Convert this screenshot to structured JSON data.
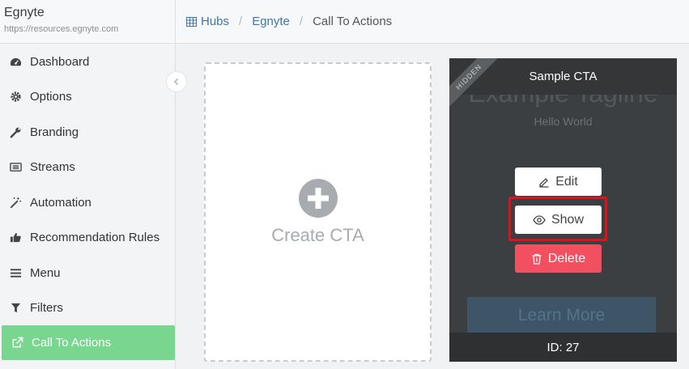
{
  "brand": {
    "title": "Egnyte",
    "url": "https://resources.egnyte.com"
  },
  "sidebar": {
    "items": [
      {
        "label": "Dashboard",
        "icon": "dashboard-icon"
      },
      {
        "label": "Options",
        "icon": "gear-icon"
      },
      {
        "label": "Branding",
        "icon": "wrench-icon"
      },
      {
        "label": "Streams",
        "icon": "list-icon"
      },
      {
        "label": "Automation",
        "icon": "magic-wand-icon"
      },
      {
        "label": "Recommendation Rules",
        "icon": "thumbs-up-icon"
      },
      {
        "label": "Menu",
        "icon": "hamburger-icon"
      },
      {
        "label": "Filters",
        "icon": "filter-icon"
      },
      {
        "label": "Call To Actions",
        "icon": "external-link-icon",
        "active": true
      }
    ]
  },
  "breadcrumb": {
    "hubs": "Hubs",
    "egnyte": "Egnyte",
    "current": "Call To Actions"
  },
  "create_card": {
    "label": "Create CTA"
  },
  "cta_card": {
    "title": "Sample CTA",
    "ribbon": "HIDDEN",
    "tagline": "Example Tagline",
    "subtitle": "Hello World",
    "learn_more": "Learn More",
    "id_label": "ID: 27",
    "edit_label": "Edit",
    "show_label": "Show",
    "delete_label": "Delete"
  },
  "colors": {
    "active_nav": "#78d68f",
    "link": "#3f77a8",
    "delete": "#f25060",
    "highlight": "#d9141a"
  }
}
